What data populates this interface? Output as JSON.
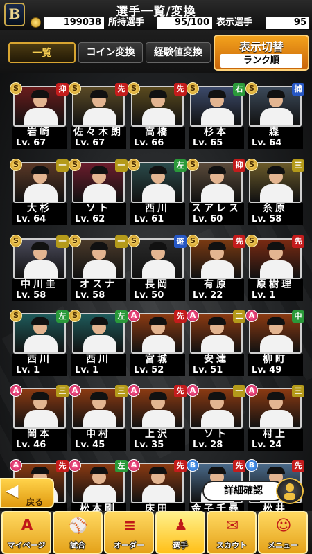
{
  "header": {
    "title": "選手一覧/変換",
    "coins": "199038",
    "owned_label": "所持選手",
    "owned_value": "95/100",
    "shown_label": "表示選手",
    "shown_value": "95",
    "logo_letter": "B"
  },
  "tabs": [
    {
      "label": "一覧",
      "active": true
    },
    {
      "label": "コイン変換",
      "active": false
    },
    {
      "label": "経験値変換",
      "active": false
    }
  ],
  "display_toggle": {
    "title": "表示切替",
    "sort": "ランク順"
  },
  "players": [
    {
      "rank": "S",
      "pos": "抑",
      "name": "岩崎",
      "lv": "Lv. 67",
      "bg": "#6a1c1c"
    },
    {
      "rank": "S",
      "pos": "先",
      "name": "佐々木朗",
      "lv": "Lv. 67",
      "bg": "#5a4a26"
    },
    {
      "rank": "S",
      "pos": "先",
      "name": "高橋",
      "lv": "Lv. 66",
      "bg": "#5a4a1e"
    },
    {
      "rank": "S",
      "pos": "右",
      "name": "杉本",
      "lv": "Lv. 65",
      "bg": "#3c4a6a"
    },
    {
      "rank": "S",
      "pos": "捕",
      "name": "森",
      "lv": "Lv. 64",
      "bg": "#3c4a5a"
    },
    {
      "rank": "S",
      "pos": "一",
      "name": "大杉",
      "lv": "Lv. 64",
      "bg": "#5a3826"
    },
    {
      "rank": "S",
      "pos": "一",
      "name": "ソト",
      "lv": "Lv. 62",
      "bg": "#6a1c2c"
    },
    {
      "rank": "S",
      "pos": "左",
      "name": "西川",
      "lv": "Lv. 61",
      "bg": "#2a4a4a"
    },
    {
      "rank": "S",
      "pos": "抑",
      "name": "スアレス",
      "lv": "Lv. 60",
      "bg": "#5a4a3a"
    },
    {
      "rank": "S",
      "pos": "三",
      "name": "糸原",
      "lv": "Lv. 58",
      "bg": "#6a5a2a"
    },
    {
      "rank": "S",
      "pos": "一",
      "name": "中川圭",
      "lv": "Lv. 58",
      "bg": "#4a4a5a"
    },
    {
      "rank": "S",
      "pos": "一",
      "name": "オスナ",
      "lv": "Lv. 58",
      "bg": "#4a3a2a"
    },
    {
      "rank": "S",
      "pos": "遊",
      "name": "長岡",
      "lv": "Lv. 50",
      "bg": "#2a2a2a"
    },
    {
      "rank": "S",
      "pos": "先",
      "name": "有原",
      "lv": "Lv. 22",
      "bg": "#7a3a12"
    },
    {
      "rank": "S",
      "pos": "先",
      "name": "原樹理",
      "lv": "Lv. 1",
      "bg": "#7a2a12"
    },
    {
      "rank": "S",
      "pos": "左",
      "name": "西川",
      "lv": "Lv. 1",
      "bg": "#1e5a5a"
    },
    {
      "rank": "S",
      "pos": "左",
      "name": "西川",
      "lv": "Lv. 1",
      "bg": "#1e5a5a"
    },
    {
      "rank": "A",
      "pos": "先",
      "name": "宮城",
      "lv": "Lv. 52",
      "bg": "#8a3a12"
    },
    {
      "rank": "A",
      "pos": "二",
      "name": "安達",
      "lv": "Lv. 51",
      "bg": "#8a3a12"
    },
    {
      "rank": "A",
      "pos": "中",
      "name": "柳町",
      "lv": "Lv. 49",
      "bg": "#8a3a12"
    },
    {
      "rank": "A",
      "pos": "三",
      "name": "岡本",
      "lv": "Lv. 46",
      "bg": "#8a3a12"
    },
    {
      "rank": "A",
      "pos": "三",
      "name": "中村",
      "lv": "Lv. 45",
      "bg": "#8a3a12"
    },
    {
      "rank": "A",
      "pos": "先",
      "name": "上沢",
      "lv": "Lv. 35",
      "bg": "#8a3a12"
    },
    {
      "rank": "A",
      "pos": "一",
      "name": "ソト",
      "lv": "Lv. 28",
      "bg": "#8a3a12"
    },
    {
      "rank": "A",
      "pos": "三",
      "name": "村上",
      "lv": "Lv. 24",
      "bg": "#8a3a12"
    },
    {
      "rank": "A",
      "pos": "先",
      "name": "",
      "lv": "",
      "bg": "#8a3a12"
    },
    {
      "rank": "A",
      "pos": "左",
      "name": "松本剛",
      "lv": "",
      "bg": "#8a3a12"
    },
    {
      "rank": "A",
      "pos": "先",
      "name": "床田",
      "lv": "",
      "bg": "#8a3a12"
    },
    {
      "rank": "B",
      "pos": "先",
      "name": "金子千尋",
      "lv": "",
      "bg": "#4a6a8a"
    },
    {
      "rank": "B",
      "pos": "先",
      "name": "松井",
      "lv": "",
      "bg": "#4a6a8a"
    }
  ],
  "detail_button": {
    "label": "詳細確認"
  },
  "back_button": {
    "label": "戻る"
  },
  "nav": [
    {
      "label": "マイページ",
      "icon": "A"
    },
    {
      "label": "試合",
      "icon": "⚾"
    },
    {
      "label": "オーダー",
      "icon": "≡"
    },
    {
      "label": "選手",
      "icon": "♟"
    },
    {
      "label": "スカウト",
      "icon": "✉"
    },
    {
      "label": "メニュー",
      "icon": "☺"
    }
  ]
}
